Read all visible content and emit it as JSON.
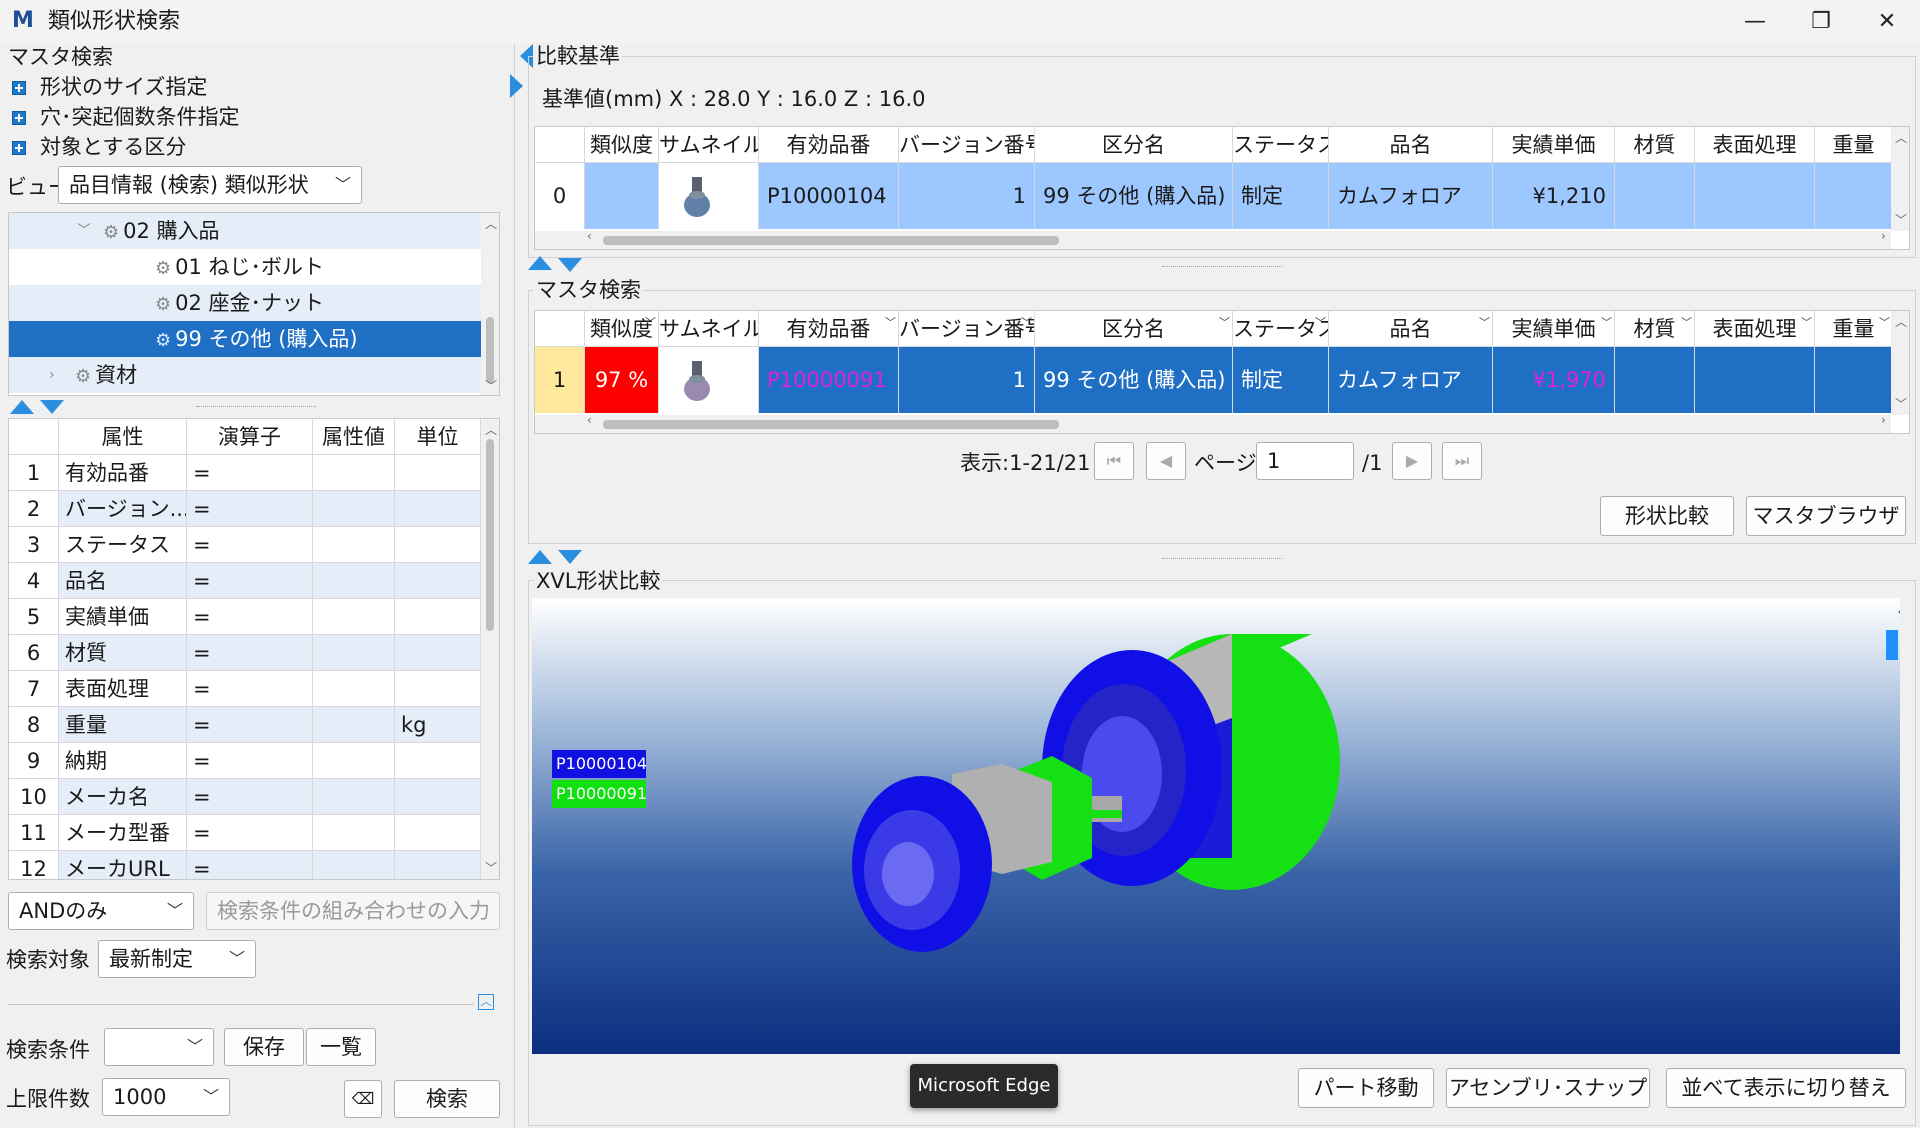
{
  "window": {
    "title": "類似形状検索",
    "logo": "M"
  },
  "left": {
    "master_search_label": "マスタ検索",
    "expanders": [
      "形状のサイズ指定",
      "穴･突起個数条件指定",
      "対象とする区分"
    ],
    "view_label": "ビュー",
    "view_value": "品目情報 (検索) 類似形状",
    "tree": [
      {
        "label": "02 購入品",
        "level": 1,
        "selected": false,
        "alt": true,
        "toggle": "v"
      },
      {
        "label": "01 ねじ･ボルト",
        "level": 2,
        "selected": false,
        "alt": false,
        "toggle": ""
      },
      {
        "label": "02 座金･ナット",
        "level": 2,
        "selected": false,
        "alt": true,
        "toggle": ""
      },
      {
        "label": "99 その他 (購入品)",
        "level": 2,
        "selected": true,
        "alt": false,
        "toggle": ""
      },
      {
        "label": "資材",
        "level": 0,
        "selected": false,
        "alt": true,
        "toggle": ">"
      }
    ],
    "attr_headers": [
      "属性",
      "演算子",
      "属性値",
      "単位"
    ],
    "attr_rows": [
      {
        "no": "1",
        "attr": "有効品番",
        "op": "=",
        "val": "",
        "unit": ""
      },
      {
        "no": "2",
        "attr": "バージョン...",
        "op": "=",
        "val": "",
        "unit": ""
      },
      {
        "no": "3",
        "attr": "ステータス",
        "op": "=",
        "val": "",
        "unit": ""
      },
      {
        "no": "4",
        "attr": "品名",
        "op": "=",
        "val": "",
        "unit": ""
      },
      {
        "no": "5",
        "attr": "実績単価",
        "op": "=",
        "val": "",
        "unit": ""
      },
      {
        "no": "6",
        "attr": "材質",
        "op": "=",
        "val": "",
        "unit": ""
      },
      {
        "no": "7",
        "attr": "表面処理",
        "op": "=",
        "val": "",
        "unit": ""
      },
      {
        "no": "8",
        "attr": "重量",
        "op": "=",
        "val": "",
        "unit": "kg"
      },
      {
        "no": "9",
        "attr": "納期",
        "op": "=",
        "val": "",
        "unit": ""
      },
      {
        "no": "10",
        "attr": "メーカ名",
        "op": "=",
        "val": "",
        "unit": ""
      },
      {
        "no": "11",
        "attr": "メーカ型番",
        "op": "=",
        "val": "",
        "unit": ""
      },
      {
        "no": "12",
        "attr": "メーカURL",
        "op": "=",
        "val": "",
        "unit": ""
      }
    ],
    "and_mode": "ANDのみ",
    "combo_input_placeholder": "検索条件の組み合わせの入力",
    "search_target_label": "検索対象",
    "search_target_value": "最新制定",
    "conditions_label": "検索条件",
    "conditions_value": "",
    "save_btn": "保存",
    "list_btn": "一覧",
    "limit_label": "上限件数",
    "limit_value": "1000",
    "search_btn": "検索"
  },
  "compare": {
    "label": "比較基準",
    "base_text": "基準値(mm)  X : 28.0  Y : 16.0  Z : 16.0",
    "headers": [
      "類似度",
      "サムネイル",
      "有効品番",
      "バージョン番号",
      "区分名",
      "ステータス",
      "品名",
      "実績単価",
      "材質",
      "表面処理",
      "重量"
    ],
    "row": {
      "no": "0",
      "sim": "",
      "part": "P10000104",
      "ver": "1",
      "cat": "99 その他 (購入品)",
      "status": "制定",
      "name": "カムフォロア",
      "price": "¥1,210",
      "mat": "",
      "surf": "",
      "weight": ""
    }
  },
  "master": {
    "label": "マスタ検索",
    "headers": [
      "類似度",
      "サムネイル",
      "有効品番",
      "バージョン番号",
      "区分名",
      "ステータス",
      "品名",
      "実績単価",
      "材質",
      "表面処理",
      "重量"
    ],
    "row": {
      "no": "1",
      "sim": "97 %",
      "part": "P10000091",
      "ver": "1",
      "cat": "99 その他 (購入品)",
      "status": "制定",
      "name": "カムフォロア",
      "price": "¥1,970",
      "mat": "",
      "surf": "",
      "weight": ""
    },
    "display_range": "表示:1-21/21",
    "page_label": "ページ:",
    "page_value": "1",
    "page_total": "/1",
    "shape_compare_btn": "形状比較",
    "master_browser_btn": "マスタブラウザ"
  },
  "xvl": {
    "label": "XVL形状比較",
    "legend": [
      {
        "name": "P10000104",
        "color": "#1010e0"
      },
      {
        "name": "P10000091",
        "color": "#10e010"
      }
    ],
    "tooltip": "Microsoft Edge",
    "part_move_btn": "パート移動",
    "assembly_snap_btn": "アセンブリ･スナップ",
    "side_by_side_btn": "並べて表示に切り替え"
  },
  "colors": {
    "selected": "#1f6fc5",
    "similarity_bad": "#ff0000",
    "row_highlight": "#9cc8ff",
    "magenta_text": "#e020e0"
  }
}
